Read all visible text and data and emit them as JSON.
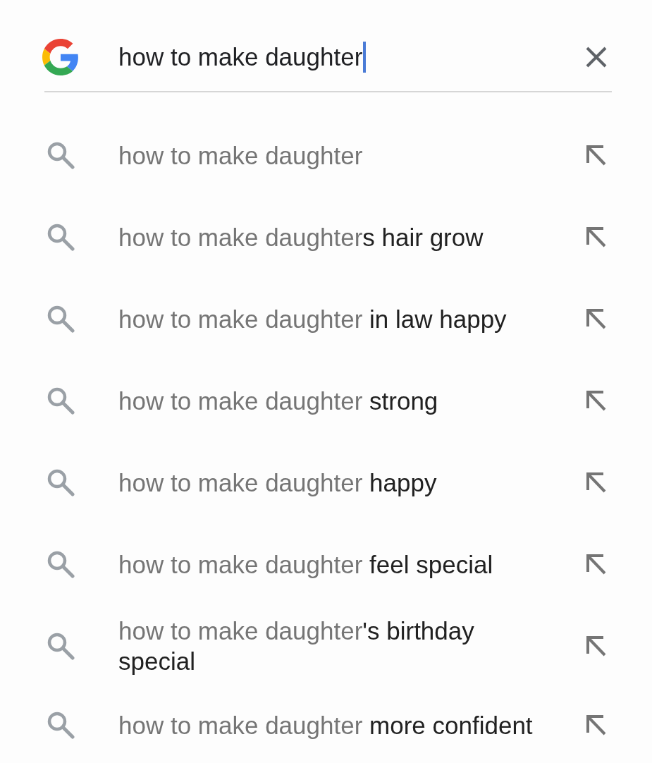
{
  "search": {
    "value": "how to make daughter",
    "focused": true
  },
  "suggestions": [
    {
      "query": "how to make daughter"
    },
    {
      "query": "how to make daughter",
      "completion": "s hair grow"
    },
    {
      "query": "how to make daughter",
      "completion": " in law happy"
    },
    {
      "query": "how to make daughter",
      "completion": " strong"
    },
    {
      "query": "how to make daughter",
      "completion": " happy"
    },
    {
      "query": "how to make daughter",
      "completion": " feel special"
    },
    {
      "query": "how to make daughter",
      "completion": "'s birthday special"
    },
    {
      "query": "how to make daughter",
      "completion": " more confident"
    }
  ]
}
